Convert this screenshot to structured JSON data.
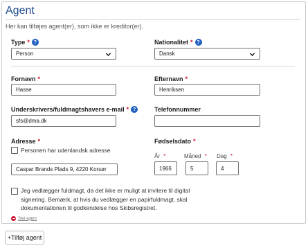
{
  "section": {
    "title": "Agent",
    "subtitle": "Her kan tilføjes agent(er), som ikke er kreditor(er)."
  },
  "type": {
    "label": "Type",
    "required_mark": "*",
    "help_icon": "?",
    "value": "Person"
  },
  "nationality": {
    "label": "Nationalitet",
    "required_mark": "*",
    "help_icon": "?",
    "value": "Dansk"
  },
  "first_name": {
    "label": "Fornavn",
    "required_mark": "*",
    "value": "Hasse"
  },
  "last_name": {
    "label": "Efternavn",
    "required_mark": "*",
    "value": "Henriksen"
  },
  "email": {
    "label": "Underskrivers/fuldmagtshavers e-mail",
    "required_mark": "*",
    "help_icon": "?",
    "value": "sfs@dma.dk"
  },
  "phone": {
    "label": "Telefonnummer",
    "value": ""
  },
  "address": {
    "label": "Adresse",
    "required_mark": "*",
    "foreign_checkbox_label": "Personen har udenlandsk adresse",
    "foreign_checked": false,
    "value": "Caspar Brands Plads 9, 4220 Korsør"
  },
  "birthdate": {
    "label": "Fødselsdato",
    "required_mark": "*",
    "year_label": "År",
    "month_label": "Måned",
    "day_label": "Dag",
    "year": "1966",
    "month": "5",
    "day": "4"
  },
  "power_of_attorney": {
    "checked": false,
    "line1": "Jeg vedlægger fuldmagt, da det ikke er muligt at invitere til digital",
    "line2": "signering. Bemærk, at hvis du vedlægger en papirfuldmagt, skal",
    "line3": "dokumentationen til godkendelse hos Skibsregistret."
  },
  "delete_agent_label": "Slet agent",
  "add_agent_label": "+Tilføj agent",
  "colors": {
    "title": "#1f4b8e",
    "required": "#c8102e",
    "help_icon_bg": "#1f5fbf",
    "input_border": "#6d6d6d"
  }
}
